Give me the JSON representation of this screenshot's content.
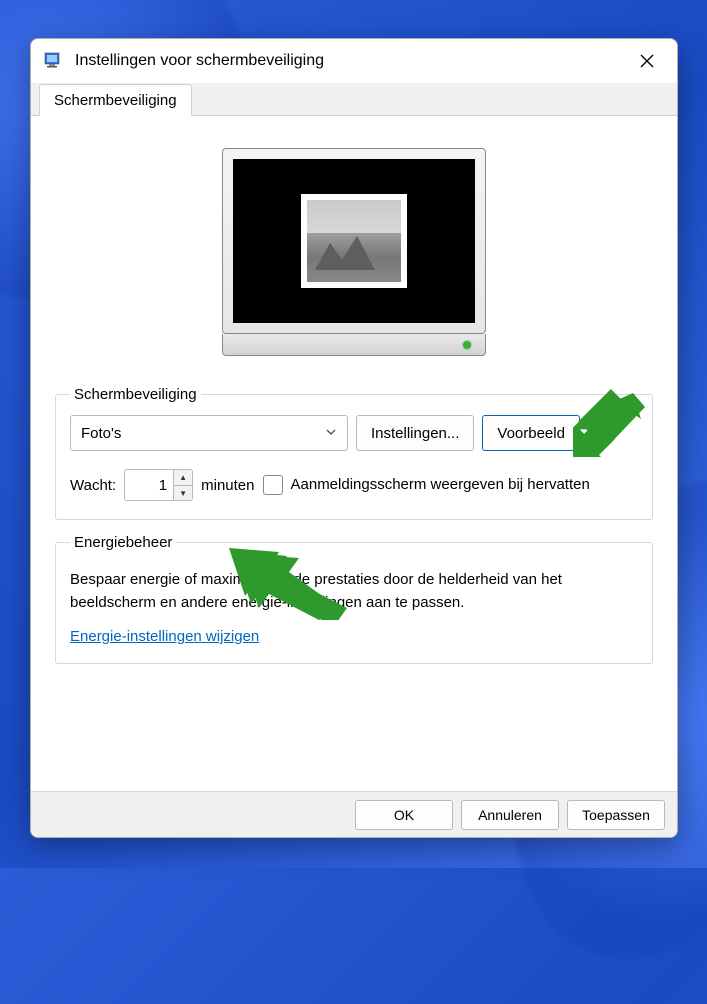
{
  "window": {
    "title": "Instellingen voor schermbeveiliging"
  },
  "tabs": {
    "main": "Schermbeveiliging"
  },
  "screensaver": {
    "legend": "Schermbeveiliging",
    "selected": "Foto's",
    "settings_btn": "Instellingen...",
    "preview_btn": "Voorbeeld",
    "wait_label": "Wacht:",
    "wait_value": "1",
    "minutes_label": "minuten",
    "logon_checkbox_label": "Aanmeldingsscherm weergeven bij hervatten"
  },
  "power": {
    "legend": "Energiebeheer",
    "text": "Bespaar energie of maximaliseer de prestaties door de helderheid van het beeldscherm en andere energie-instellingen aan te passen.",
    "link": "Energie-instellingen wijzigen"
  },
  "footer": {
    "ok": "OK",
    "cancel": "Annuleren",
    "apply": "Toepassen"
  },
  "colors": {
    "arrow": "#2e9a2e"
  }
}
